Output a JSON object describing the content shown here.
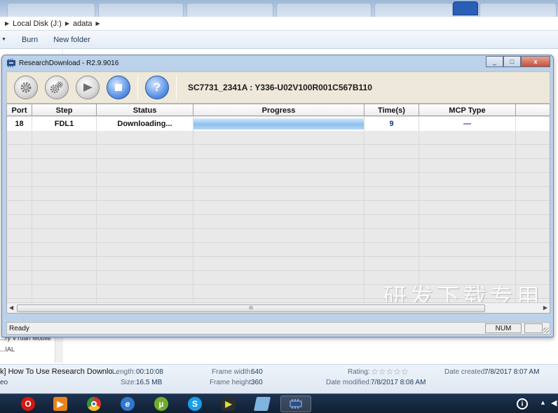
{
  "explorer": {
    "breadcrumb": [
      "Local Disk (J:)",
      "adata"
    ],
    "commands": [
      "Burn",
      "New folder"
    ],
    "nav_fragments": [
      "...ry VTuan Mobile",
      "...IAL"
    ]
  },
  "app": {
    "title": "ResearchDownload - R2.9.9016",
    "caption_buttons": [
      "_",
      "□",
      "x"
    ],
    "toolbar": {
      "load_packet_icon": "gear-icon",
      "settings_icon": "gears-icon",
      "start_icon": "play-icon",
      "stop_icon": "stop-icon",
      "help_label": "?"
    },
    "device_label": "SC7731_2341A : Y336-U02V100R001C567B110",
    "grid": {
      "columns": [
        "Port",
        "Step",
        "Status",
        "Progress",
        "Time(s)",
        "MCP Type"
      ],
      "rows": [
        {
          "port": "18",
          "step": "FDL1",
          "status": "Downloading...",
          "progress": 1.0,
          "time": "9",
          "mcp": "—"
        }
      ]
    },
    "watermark": "研发下载专用",
    "scrollbar_grip": "III",
    "status": {
      "left": "Ready",
      "num": "NUM"
    }
  },
  "details_pane": {
    "title": "k] How To Use Research Downlo...",
    "type": "eo",
    "length_label": "Length:",
    "length": "00:10:08",
    "size_label": "Size:",
    "size": "16.5 MB",
    "frame_width_label": "Frame width:",
    "frame_width": "640",
    "frame_height_label": "Frame height:",
    "frame_height": "360",
    "rating_label": "Rating:",
    "rating": "☆☆☆☆☆",
    "date_modified_label": "Date modified:",
    "date_modified": "7/8/2017 8:08 AM",
    "date_created_label": "Date created:",
    "date_created": "7/8/2017 8:07 AM"
  },
  "taskbar": {
    "items": [
      "opera-icon",
      "media-player-icon",
      "chrome-icon",
      "internet-explorer-icon",
      "utorrent-icon",
      "skype-icon",
      "video-player-icon",
      "notepad-icon",
      "research-download-icon"
    ],
    "colors": {
      "opera": "#d01a12",
      "media": "#e8821e",
      "chrome": "#3b8f3b",
      "ie": "#2f78d0",
      "utorrent": "#6fae2a",
      "skype": "#1b9ee8",
      "video": "#2d2d2d",
      "notepad": "#7fb4e0",
      "research": "#2b4d8c"
    }
  }
}
